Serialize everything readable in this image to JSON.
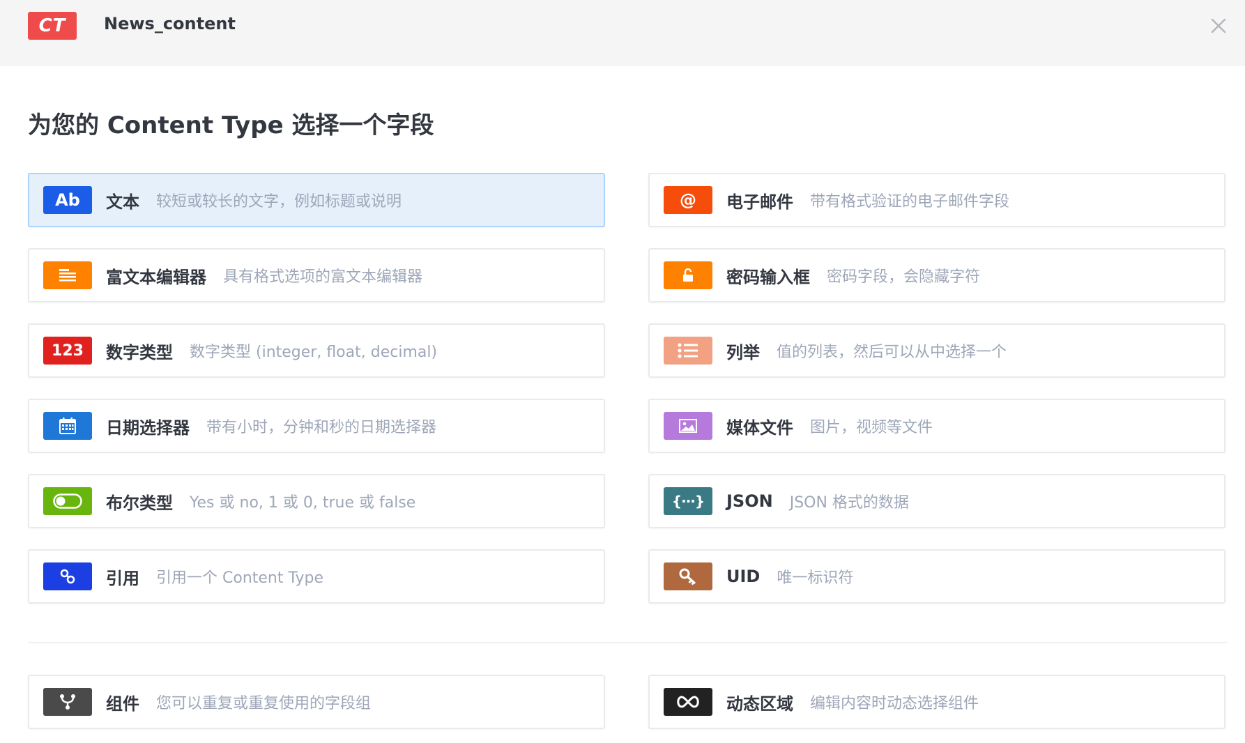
{
  "header": {
    "badge": "CT",
    "title": "News_content"
  },
  "page_title": "为您的 Content Type 选择一个字段",
  "fields": [
    {
      "id": "text",
      "icon_text": "Ab",
      "icon": "text-icon",
      "color": "#1c5de7",
      "name": "文本",
      "desc": "较短或较长的文字，例如标题或说明",
      "active": true
    },
    {
      "id": "email",
      "icon_text": "@",
      "icon": "at-sign-icon",
      "color": "#f64d0a",
      "name": "电子邮件",
      "desc": "带有格式验证的电子邮件字段"
    },
    {
      "id": "richtext",
      "icon_text": "",
      "icon": "align-left-icon",
      "color": "#ff8100",
      "name": "富文本编辑器",
      "desc": "具有格式选项的富文本编辑器"
    },
    {
      "id": "password",
      "icon_text": "",
      "icon": "lock-icon",
      "color": "#ff8100",
      "name": "密码输入框",
      "desc": "密码字段，会隐藏字符"
    },
    {
      "id": "number",
      "icon_text": "123",
      "icon": "number-icon",
      "color": "#e1211f",
      "name": "数字类型",
      "desc": "数字类型 (integer, float, decimal)"
    },
    {
      "id": "enum",
      "icon_text": "",
      "icon": "list-icon",
      "color": "#f2a183",
      "name": "列举",
      "desc": "值的列表，然后可以从中选择一个"
    },
    {
      "id": "date",
      "icon_text": "",
      "icon": "calendar-icon",
      "color": "#1f77d8",
      "name": "日期选择器",
      "desc": "带有小时，分钟和秒的日期选择器"
    },
    {
      "id": "media",
      "icon_text": "",
      "icon": "image-icon",
      "color": "#b67adc",
      "name": "媒体文件",
      "desc": "图片，视频等文件"
    },
    {
      "id": "boolean",
      "icon_text": "",
      "icon": "toggle-icon",
      "color": "#68b50d",
      "name": "布尔类型",
      "desc": "Yes 或 no, 1 或 0, true 或 false"
    },
    {
      "id": "json",
      "icon_text": "{···}",
      "icon": "braces-icon",
      "color": "#3a7a84",
      "name": "JSON",
      "desc": "JSON 格式的数据"
    },
    {
      "id": "relation",
      "icon_text": "",
      "icon": "link-icon",
      "color": "#1b3fe3",
      "name": "引用",
      "desc": "引用一个 Content Type"
    },
    {
      "id": "uid",
      "icon_text": "",
      "icon": "key-icon",
      "color": "#b0683e",
      "name": "UID",
      "desc": "唯一标识符"
    }
  ],
  "extra_fields": [
    {
      "id": "component",
      "icon_text": "",
      "icon": "fork-icon",
      "color": "#4a4a4a",
      "name": "组件",
      "desc": "您可以重复或重复使用的字段组"
    },
    {
      "id": "dynamiczone",
      "icon_text": "",
      "icon": "infinity-icon",
      "color": "#222222",
      "name": "动态区域",
      "desc": "编辑内容时动态选择组件"
    }
  ]
}
